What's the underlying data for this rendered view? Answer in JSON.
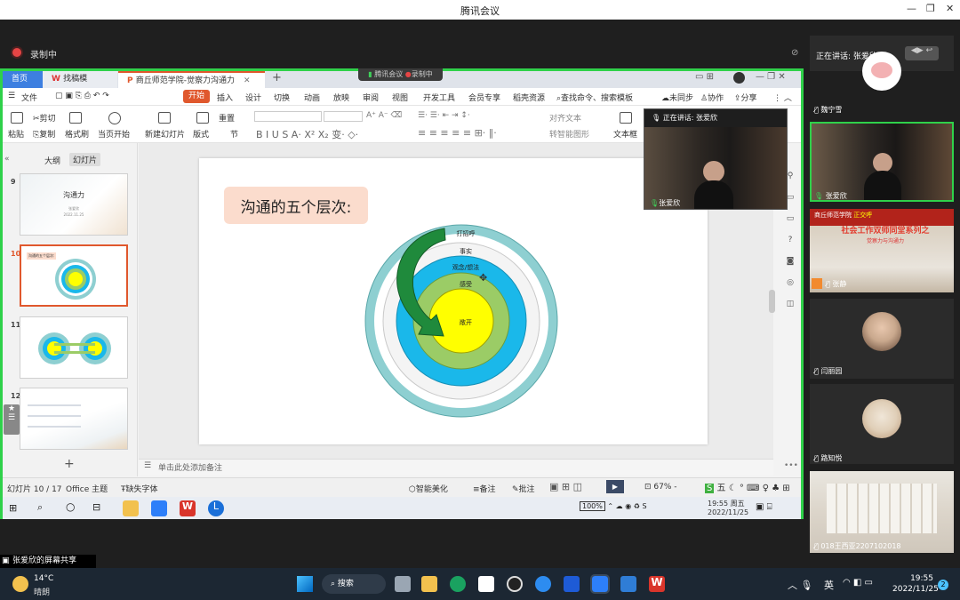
{
  "meeting": {
    "title": "腾讯会议",
    "recording": "录制中",
    "speaking_now": "正在讲话: 张爱欣",
    "share_caption": "张爱欣的屏幕共享"
  },
  "wps": {
    "tabs": {
      "home": "首页",
      "templates": "找稿模",
      "doc": "商丘师范学院-觉察力沟通力"
    },
    "overlay": {
      "meeting": "腾讯会议",
      "rec": "录制中"
    },
    "menu": [
      "文件",
      "开始",
      "插入",
      "设计",
      "切换",
      "动画",
      "放映",
      "审阅",
      "视图",
      "开发工具",
      "会员专享",
      "稻壳资源"
    ],
    "search_placeholder": "查找命令、搜索模板",
    "right_menu": [
      "未同步",
      "协作",
      "分享"
    ],
    "ribbon": {
      "cut": "剪切",
      "copy": "复制",
      "paste": "粘贴",
      "format_painter": "格式刷",
      "play": "当页开始",
      "new_slide": "新建幻灯片",
      "layout": "版式",
      "section": "节",
      "reset": "重置",
      "align_text": "对齐文本",
      "smart": "转智能图形",
      "textbox": "文本框"
    },
    "panel_tabs": {
      "outline": "大纲",
      "slides": "幻灯片"
    },
    "slides": [
      {
        "num": "9",
        "title": "沟通力",
        "sub": "张爱欣",
        "date": "2022.11.25"
      },
      {
        "num": "10",
        "tag": "沟通的五个层次:"
      },
      {
        "num": "11"
      },
      {
        "num": "12"
      }
    ],
    "slide": {
      "title": "沟通的五个层次:",
      "rings": [
        "打招呼",
        "事实",
        "观念/想法",
        "感受",
        "敞开"
      ]
    },
    "notes": "单击此处添加备注",
    "status": {
      "slide_pos": "幻灯片 10 / 17",
      "theme": "Office 主题",
      "font_missing": "缺失字体",
      "beautify": "智能美化",
      "notes_btn": "备注",
      "comment": "批注",
      "zoom": "67%"
    },
    "inner_taskbar": {
      "battery": "100%",
      "time": "19:55 周五",
      "date": "2022/11/25",
      "ime": "五"
    }
  },
  "pip": {
    "name": "张爱欣"
  },
  "participants": [
    {
      "name": "魏宁雪",
      "avatar_color": "#f2d7d5"
    },
    {
      "name": "张爱欣",
      "avatar_color": "#3a3a3a"
    },
    {
      "name": "张静",
      "banner": "社会工作双师同堂系列之",
      "sub": "觉察力与沟通力",
      "school": "商丘师范学院",
      "tag": "正交呼"
    },
    {
      "name": "闫丽园",
      "avatar_color": "#c9a88d"
    },
    {
      "name": "路知悦",
      "avatar_color": "#e9dccd"
    },
    {
      "name": "018王西亚2207102018",
      "avatar_color": "#d9d4cc"
    }
  ],
  "windows": {
    "weather_temp": "14°C",
    "weather_desc": "晴朗",
    "search": "搜索",
    "lang": "英",
    "time": "19:55",
    "date": "2022/11/25",
    "badge": "2"
  },
  "colors": {
    "accent_green": "#2fd14a",
    "wps_orange": "#e0582d",
    "ring_outer": "#8ecfd1",
    "ring_cyan": "#1ab8ea",
    "ring_green": "#9bcc66",
    "core_yellow": "#ffff00",
    "arrow_green": "#1f8a3c"
  }
}
